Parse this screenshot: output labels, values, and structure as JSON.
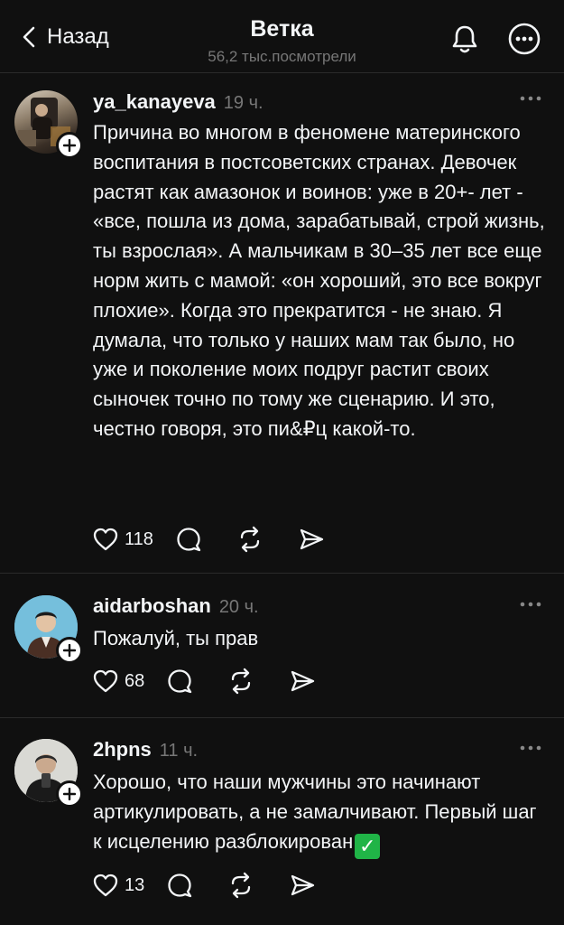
{
  "header": {
    "back_label": "Назад",
    "title": "Ветка",
    "subtitle": "56,2 тыс.посмотрели"
  },
  "posts": [
    {
      "username": "ya_kanayeva",
      "time": "19 ч.",
      "text": "Причина во многом в феномене материнского воспитания в постсоветских странах. Девочек растят как амазонок и воинов: уже в 20+- лет - «все, пошла из дома, зарабатывай, строй жизнь, ты взрослая». А мальчикам в 30–35 лет все еще норм жить с мамой: «он хороший, это все вокруг плохие». Когда это прекратится - не знаю. Я думала, что только у наших мам так было, но уже и поколение моих подруг растит своих сыночек точно по тому же сценарию. И это, честно говоря, это пи&₽ц какой-то.",
      "likes": "118"
    },
    {
      "username": "aidarboshan",
      "time": "20 ч.",
      "text": "Пожалуй, ты прав",
      "likes": "68"
    },
    {
      "username": "2hpns",
      "time": "11 ч.",
      "text": "Хорошо, что наши мужчины это начинают артикулировать, а не замалчивают. Первый шаг к исцелению разблокирован",
      "emoji": "✓",
      "likes": "13"
    }
  ],
  "icons": {
    "back": "chevron-left-icon",
    "notifications": "bell-icon",
    "menu": "more-circle-icon",
    "like": "heart-icon",
    "reply": "comment-icon",
    "repost": "repost-icon",
    "share": "send-icon"
  },
  "colors": {
    "background": "#101010",
    "text": "#f3f5f7",
    "muted": "#777777",
    "check_emoji": "#20b447"
  }
}
